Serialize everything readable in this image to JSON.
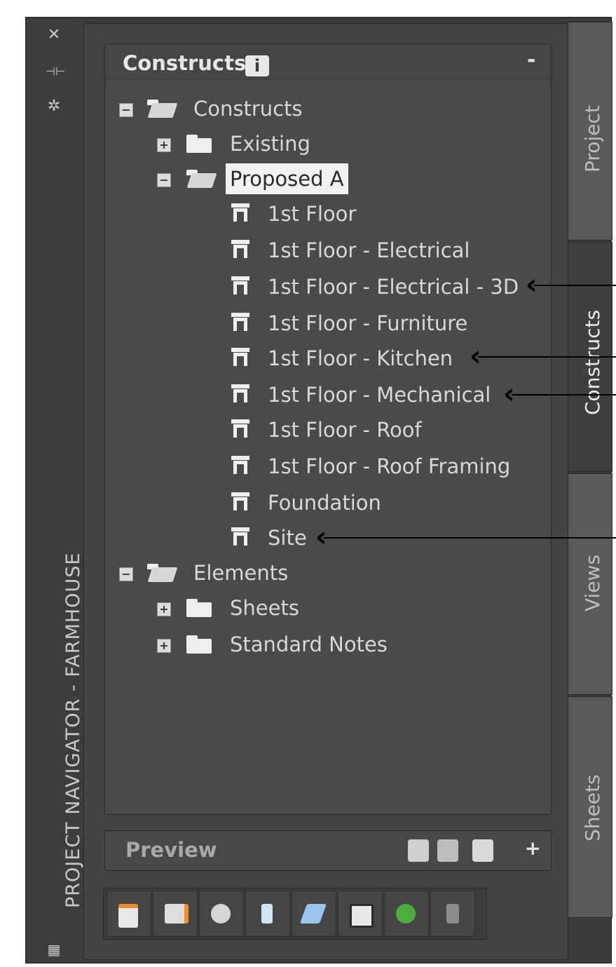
{
  "window": {
    "vertical_title": "PROJECT NAVIGATOR - FARMHOUSE",
    "close_icon": "close-icon",
    "autohide_icon": "autohide-icon",
    "properties_icon": "gear-icon"
  },
  "constructs_panel": {
    "title": "Constructs",
    "info_icon": "i",
    "collapse": "-",
    "tree": {
      "root": "Constructs",
      "existing": "Existing",
      "proposed": "Proposed A",
      "items": [
        "1st Floor",
        "1st Floor - Electrical",
        "1st Floor - Electrical - 3D",
        "1st Floor - Furniture",
        "1st Floor - Kitchen",
        "1st Floor - Mechanical",
        "1st Floor - Roof",
        "1st Floor - Roof Framing",
        "Foundation",
        "Site"
      ],
      "elements": "Elements",
      "sheets": "Sheets",
      "standard_notes": "Standard Notes"
    }
  },
  "preview": {
    "label": "Preview",
    "add": "+"
  },
  "tabs": [
    "Project",
    "Constructs",
    "Views",
    "Sheets"
  ],
  "active_tab": "Constructs",
  "colors": {
    "panel_bg": "#434343",
    "tree_bg": "#4a4a4a",
    "text": "#d8d8d8",
    "selected_bg": "#f2f2f2"
  }
}
